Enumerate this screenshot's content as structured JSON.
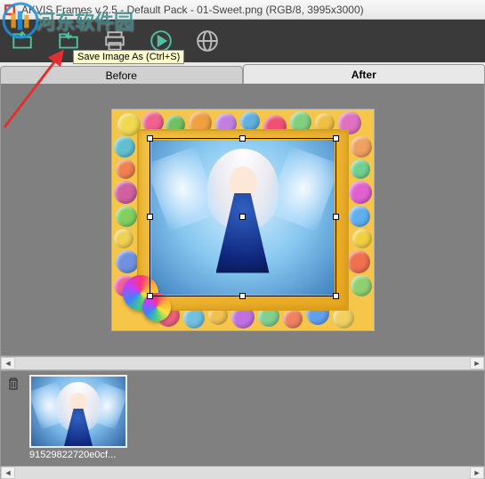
{
  "titlebar": {
    "title": "AKVIS Frames v.2.5 - Default Pack - 01-Sweet.png (RGB/8, 3995x3000)"
  },
  "toolbar": {
    "tooltip_save": "Save Image As (Ctrl+S)"
  },
  "tabs": {
    "before": "Before",
    "after": "After"
  },
  "thumbs": {
    "item0": {
      "label": "91529822720e0cf..."
    }
  },
  "watermark": {
    "text": "河东软件园"
  },
  "icons": {
    "app": "frames-app-icon",
    "open": "folder-open-icon",
    "save": "save-export-icon",
    "print": "print-icon",
    "play": "run-icon",
    "web": "globe-icon",
    "trash": "trash-icon"
  }
}
